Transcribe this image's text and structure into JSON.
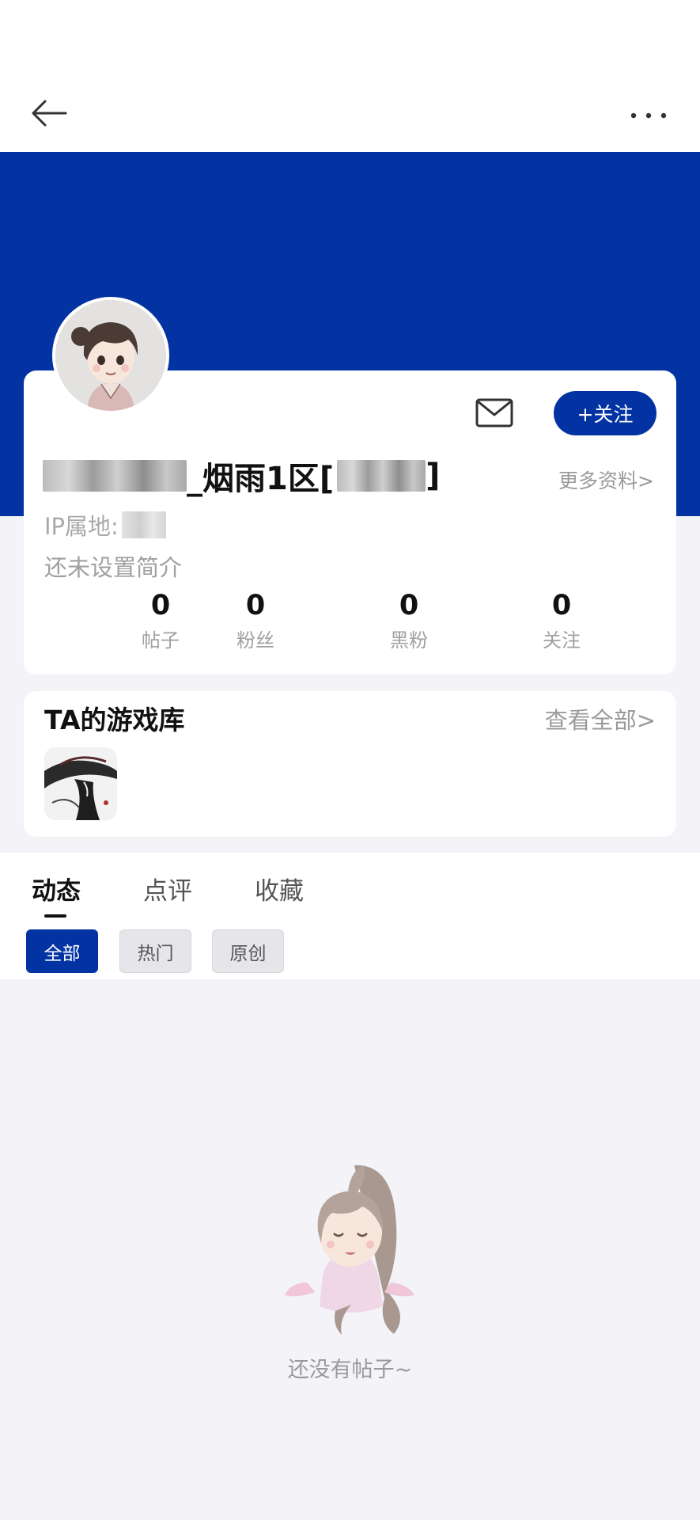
{
  "colors": {
    "brand": "#0333a3",
    "page_bg": "#f3f3f8",
    "card_bg": "#ffffff",
    "muted_text": "#9a9a9a"
  },
  "header": {
    "back_icon": "arrow-left-icon",
    "more_icon": "more-horizontal-icon"
  },
  "profile": {
    "username_suffix": "_烟雨1区[",
    "username_close": "]",
    "more_info_label": "更多资料>",
    "ip_label": "IP属地:",
    "bio": "还未设置简介",
    "follow_label": "+关注",
    "message_icon": "mail-icon",
    "stats": [
      {
        "value": "0",
        "label": "帖子"
      },
      {
        "value": "0",
        "label": "粉丝"
      },
      {
        "value": "0",
        "label": "黑粉"
      },
      {
        "value": "0",
        "label": "关注"
      }
    ]
  },
  "game_library": {
    "title": "TA的游戏库",
    "view_all_label": "查看全部>"
  },
  "feed": {
    "tabs": [
      {
        "label": "动态",
        "active": true
      },
      {
        "label": "点评",
        "active": false
      },
      {
        "label": "收藏",
        "active": false
      }
    ],
    "filters": [
      {
        "label": "全部",
        "active": true
      },
      {
        "label": "热门",
        "active": false
      },
      {
        "label": "原创",
        "active": false
      }
    ],
    "empty_text": "还没有帖子~"
  }
}
